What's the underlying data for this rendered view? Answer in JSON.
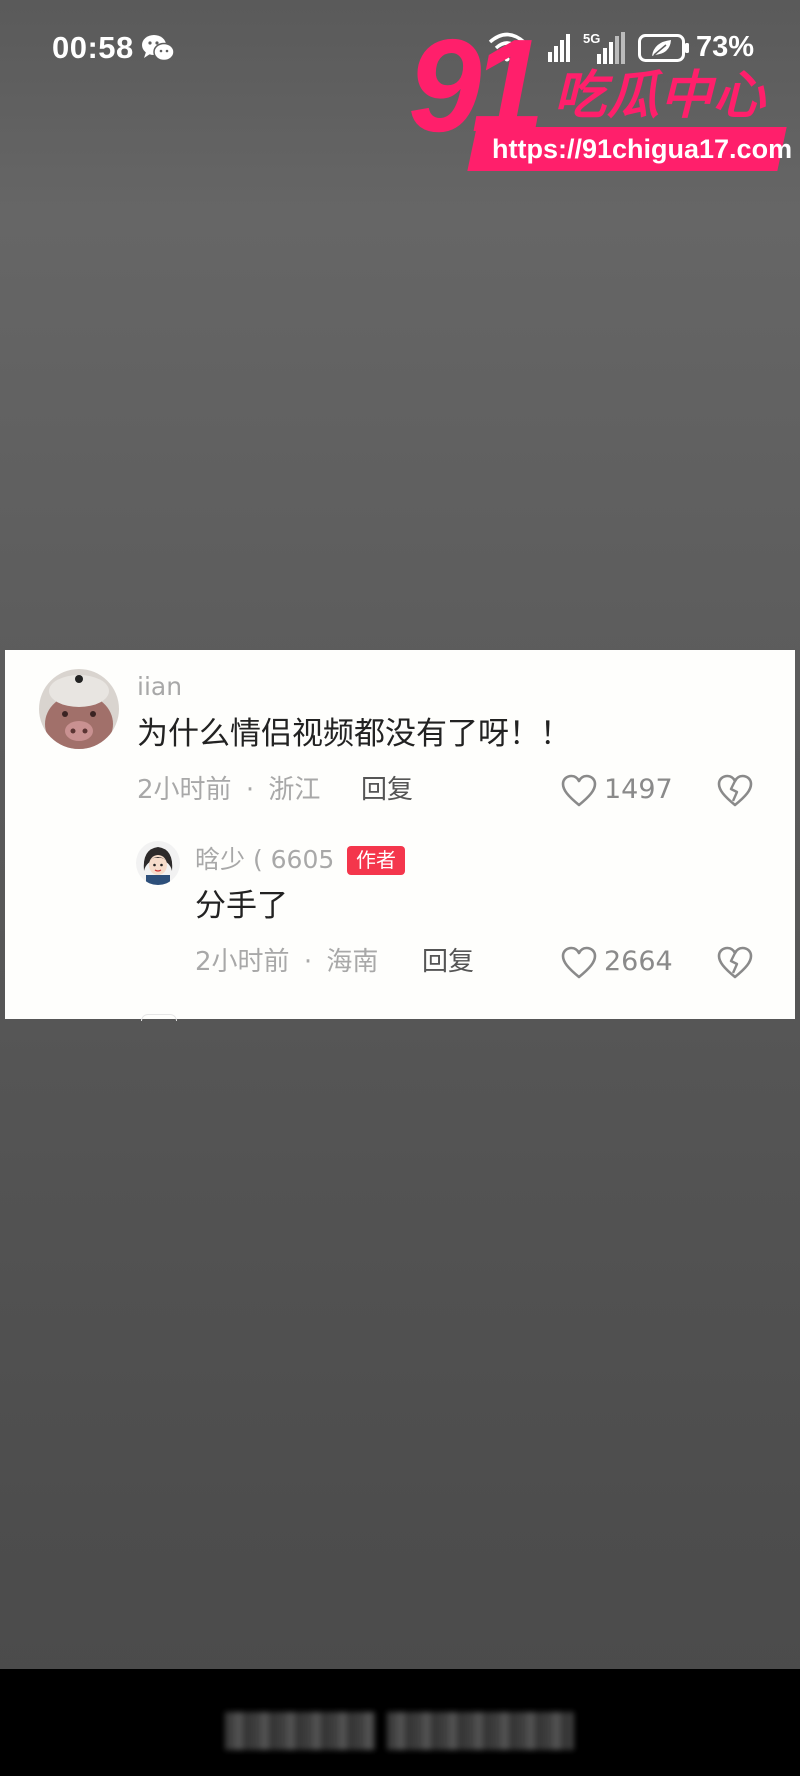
{
  "status_bar": {
    "time": "00:58",
    "battery": "73%",
    "network": "5G",
    "icons": [
      "wechat-icon",
      "wifi-icon",
      "signal-icon",
      "signal-5g-icon",
      "battery-saver-icon"
    ]
  },
  "watermark": {
    "number": "91",
    "title": "吃瓜中心",
    "url": "https://91chigua17.com"
  },
  "comments": [
    {
      "username": "iian",
      "text": "为什么情侣视频都没有了呀！！",
      "time": "2小时前",
      "separator": "·",
      "location": "浙江",
      "reply_label": "回复",
      "likes": "1497",
      "avatar": "pig-avatar"
    },
    {
      "username": "晗少 ( 6605",
      "badge": "作者",
      "text": "分手了",
      "time": "2小时前",
      "separator": "·",
      "location": "海南",
      "reply_label": "回复",
      "likes": "2664",
      "avatar": "cartoon-girl-avatar"
    }
  ],
  "colors": {
    "background": "#585858",
    "card": "#fefefc",
    "accent": "#ff1f6b",
    "badge": "#f4364c"
  }
}
